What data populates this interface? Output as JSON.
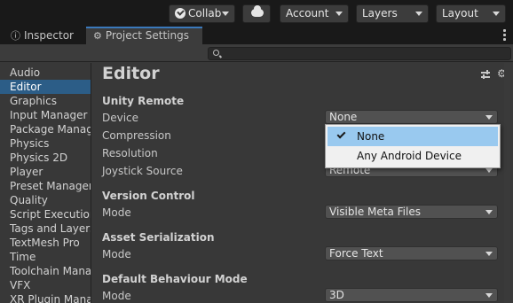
{
  "toolbar": {
    "collab_label": "Collab",
    "account_label": "Account",
    "layers_label": "Layers",
    "layout_label": "Layout"
  },
  "tabs": [
    {
      "label": "Inspector",
      "icon": "info-icon"
    },
    {
      "label": "Project Settings",
      "icon": "gear-icon"
    }
  ],
  "search": {
    "placeholder": ""
  },
  "sidebar": {
    "items": [
      {
        "label": "Audio"
      },
      {
        "label": "Editor",
        "selected": true
      },
      {
        "label": "Graphics"
      },
      {
        "label": "Input Manager"
      },
      {
        "label": "Package Manag"
      },
      {
        "label": "Physics"
      },
      {
        "label": "Physics 2D"
      },
      {
        "label": "Player"
      },
      {
        "label": "Preset Manager"
      },
      {
        "label": "Quality"
      },
      {
        "label": "Script Execution"
      },
      {
        "label": "Tags and Layers"
      },
      {
        "label": "TextMesh Pro"
      },
      {
        "label": "Time"
      },
      {
        "label": "Toolchain Mana"
      },
      {
        "label": "VFX"
      },
      {
        "label": "XR Plugin Manag"
      }
    ]
  },
  "main": {
    "title": "Editor",
    "unity_remote": {
      "heading": "Unity Remote",
      "device_label": "Device",
      "device_value": "None",
      "compression_label": "Compression",
      "resolution_label": "Resolution",
      "joystick_label": "Joystick Source",
      "joystick_value": "Remote"
    },
    "version_control": {
      "heading": "Version Control",
      "mode_label": "Mode",
      "mode_value": "Visible Meta Files"
    },
    "asset_serialization": {
      "heading": "Asset Serialization",
      "mode_label": "Mode",
      "mode_value": "Force Text"
    },
    "default_behaviour": {
      "heading": "Default Behaviour Mode",
      "mode_label": "Mode",
      "mode_value": "3D"
    }
  },
  "popup": {
    "options": [
      {
        "label": "None",
        "checked": true,
        "highlighted": true
      },
      {
        "label": "Any Android Device",
        "checked": false,
        "highlighted": false
      }
    ]
  },
  "colors": {
    "selection": "#2c5d87",
    "popup_highlight": "#99c9ef",
    "tab_accent": "#3a79bb"
  }
}
